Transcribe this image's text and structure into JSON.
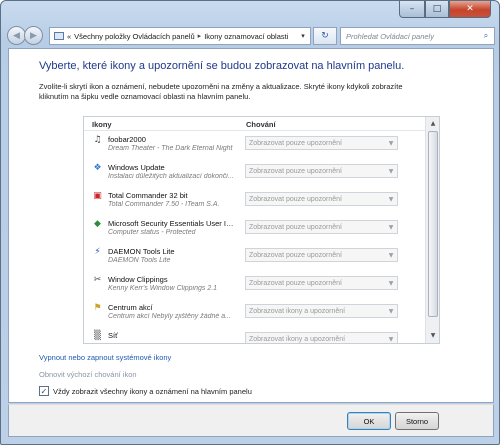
{
  "window": {
    "caption_buttons": {
      "minimize": "–",
      "maximize": "□",
      "close": "✕"
    }
  },
  "address_bar": {
    "back_glyph": "◀",
    "forward_glyph": "▶",
    "overflow": "«",
    "crumbs": [
      "Všechny položky Ovládacích panelů",
      "Ikony oznamovací oblasti"
    ],
    "separator": "▸",
    "dropdown_glyph": "▾",
    "refresh_glyph": "↻",
    "search_placeholder": "Prohledat Ovládací panely",
    "search_glyph": "⌕"
  },
  "main": {
    "heading": "Vyberte, které ikony a upozornění se budou zobrazovat na hlavním panelu.",
    "intro": "Zvolíte-li skrytí ikon a oznámení, nebudete upozorněni na změny a aktualizace. Skryté ikony kdykoli zobrazíte kliknutím na šipku vedle oznamovací oblasti na hlavním panelu.",
    "columns": {
      "icons": "Ikony",
      "behavior": "Chování"
    },
    "rows": [
      {
        "icon": "foobar-icon",
        "glyph": "♫",
        "color": "#3c3c3c",
        "title": "foobar2000",
        "subtitle": "Dream Theater - The Dark Eternal Night",
        "behavior": "Zobrazovat pouze upozornění"
      },
      {
        "icon": "windows-update-icon",
        "glyph": "❖",
        "color": "#2f7bd4",
        "title": "Windows Update",
        "subtitle": "Instalaci důležitých aktualizací dokonči...",
        "behavior": "Zobrazovat pouze upozornění"
      },
      {
        "icon": "total-commander-icon",
        "glyph": "▣",
        "color": "#c8262b",
        "title": "Total Commander 32 bit",
        "subtitle": "Total Commander 7.50 - ITeam S.A.",
        "behavior": "Zobrazovat pouze upozornění"
      },
      {
        "icon": "security-essentials-icon",
        "glyph": "◆",
        "color": "#2e8b3a",
        "title": "Microsoft Security Essentials User Inter...",
        "subtitle": "Computer status - Protected",
        "behavior": "Zobrazovat pouze upozornění"
      },
      {
        "icon": "daemon-tools-icon",
        "glyph": "⚡",
        "color": "#1f4fa8",
        "title": "DAEMON Tools Lite",
        "subtitle": "DAEMON Tools Lite",
        "behavior": "Zobrazovat pouze upozornění"
      },
      {
        "icon": "window-clippings-icon",
        "glyph": "✂",
        "color": "#4a4a4a",
        "title": "Window Clippings",
        "subtitle": "Kenny Kerr's Window Clippings 2.1",
        "behavior": "Zobrazovat pouze upozornění"
      },
      {
        "icon": "action-center-icon",
        "glyph": "⚑",
        "color": "#c9a326",
        "title": "Centrum akcí",
        "subtitle": "Centrum akcí  Nebyly zjištěny žádné a...",
        "behavior": "Zobrazovat ikony a upozornění"
      },
      {
        "icon": "network-icon",
        "glyph": "▒",
        "color": "#6b6b6b",
        "title": "Síť",
        "subtitle": "",
        "behavior": "Zobrazovat ikony a upozornění"
      }
    ],
    "select_arrow": "▼",
    "scroll_up": "▲",
    "scroll_down": "▼",
    "link_system_icons": "Vypnout nebo zapnout systémové ikony",
    "link_restore": "Obnovit výchozí chování ikon",
    "always_show_label": "Vždy zobrazit všechny ikony a oznámení na hlavním panelu",
    "always_show_checked": true,
    "check_glyph": "✓"
  },
  "footer": {
    "ok": "OK",
    "cancel": "Storno"
  }
}
